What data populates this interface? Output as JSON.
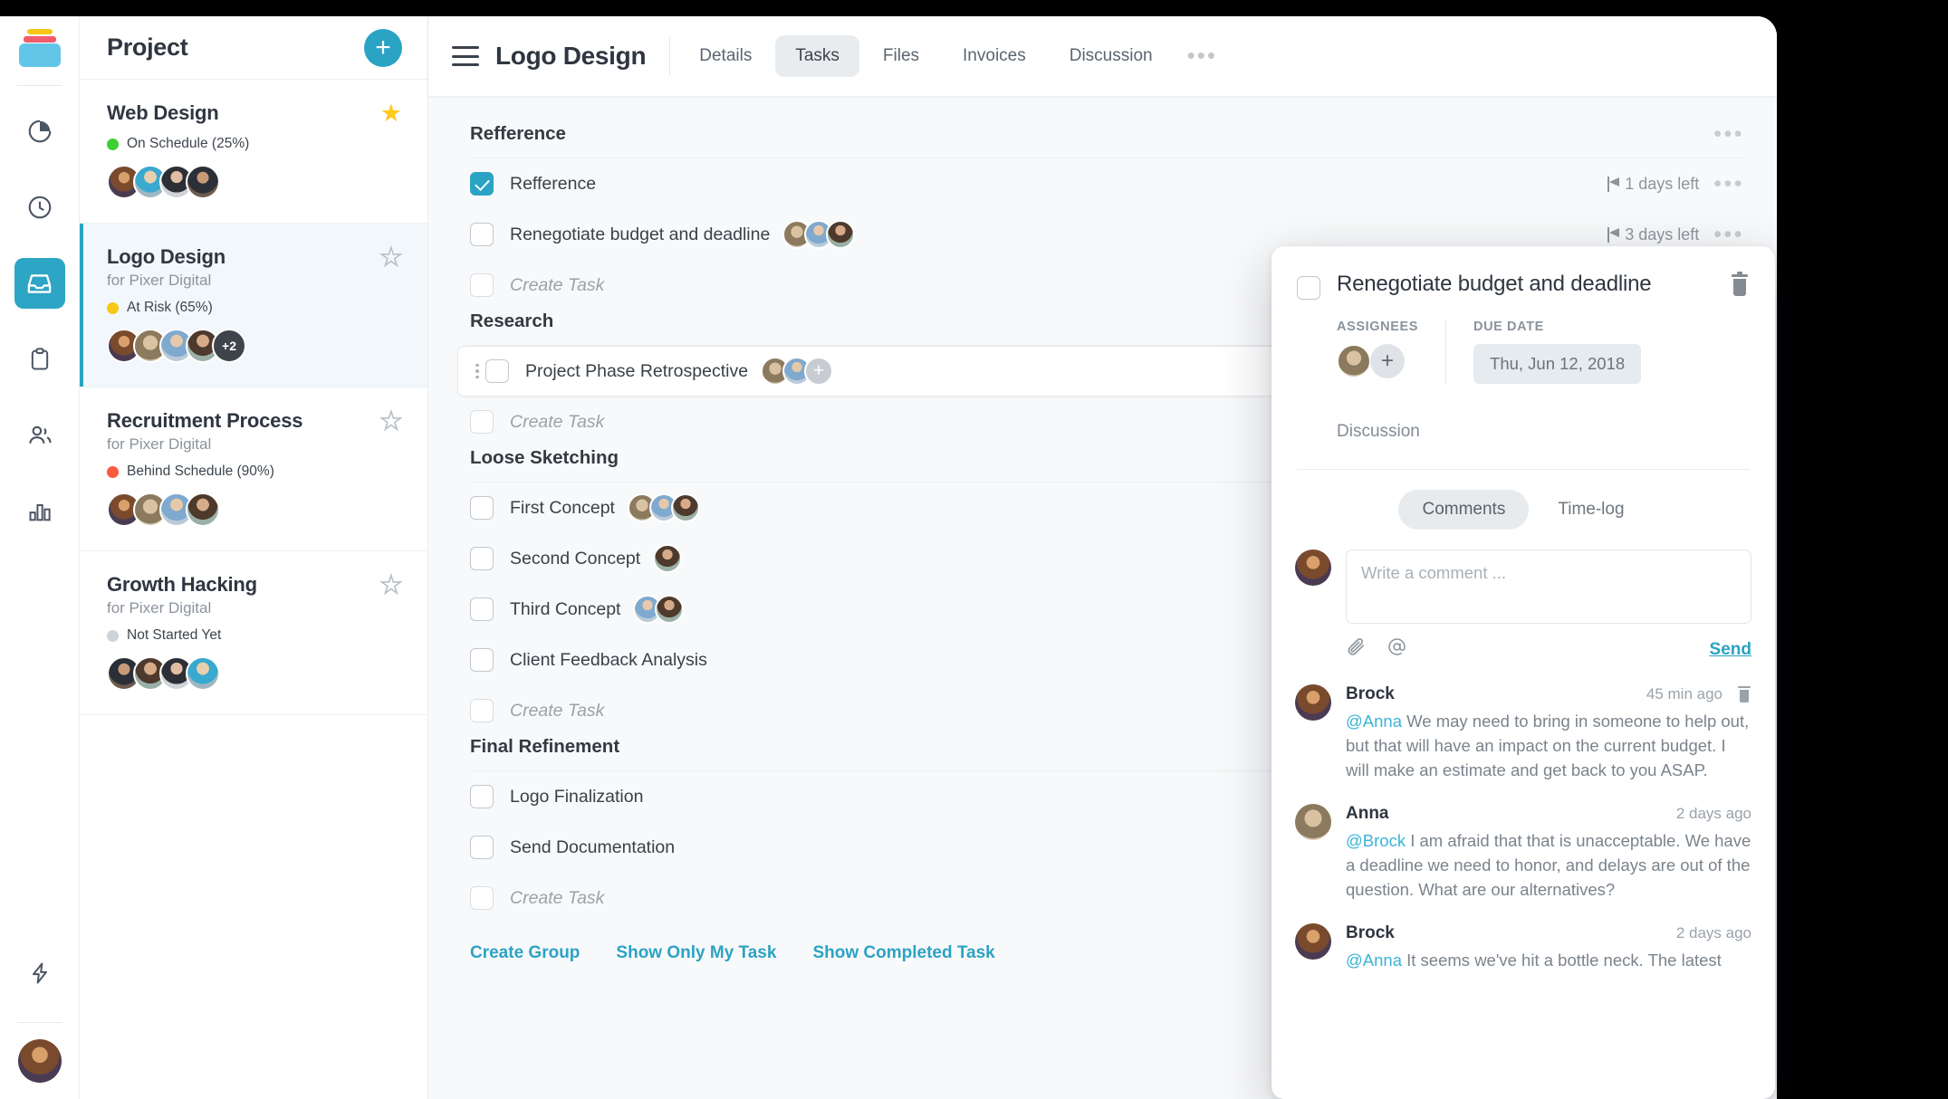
{
  "rail": {
    "logo_name": "app-logo",
    "items": [
      {
        "icon": "pie-chart-icon",
        "active": false
      },
      {
        "icon": "clock-icon",
        "active": false
      },
      {
        "icon": "inbox-icon",
        "active": true
      },
      {
        "icon": "clipboard-icon",
        "active": false
      },
      {
        "icon": "people-icon",
        "active": false
      },
      {
        "icon": "bar-chart-icon",
        "active": false
      }
    ],
    "bottom_icon": "lightning-icon",
    "avatar": "user-avatar"
  },
  "sidebar": {
    "title": "Project",
    "add_label": "+",
    "projects": [
      {
        "name": "Web Design",
        "client": "",
        "status": "On Schedule (25%)",
        "status_color": "#3fcf35",
        "starred": true,
        "selected": false,
        "avatars": [
          "a1",
          "a2",
          "a4",
          "a8"
        ],
        "extra": ""
      },
      {
        "name": "Logo Design",
        "client": "for Pixer Digital",
        "status": "At Risk (65%)",
        "status_color": "#f6c915",
        "starred": false,
        "selected": true,
        "avatars": [
          "a1",
          "a5",
          "a6",
          "a7"
        ],
        "extra": "+2"
      },
      {
        "name": "Recruitment Process",
        "client": "for Pixer Digital",
        "status": "Behind Schedule (90%)",
        "status_color": "#fb5a3c",
        "starred": false,
        "selected": false,
        "avatars": [
          "a1",
          "a5",
          "a6",
          "a7"
        ],
        "extra": ""
      },
      {
        "name": "Growth Hacking",
        "client": "for Pixer Digital",
        "status": "Not Started Yet",
        "status_color": "#cfd4d9",
        "starred": false,
        "selected": false,
        "avatars": [
          "a8",
          "a7",
          "a4",
          "a2"
        ],
        "extra": ""
      }
    ]
  },
  "topbar": {
    "menu_icon": "hamburger-icon",
    "title": "Logo Design",
    "tabs": [
      {
        "label": "Details",
        "active": false
      },
      {
        "label": "Tasks",
        "active": true
      },
      {
        "label": "Files",
        "active": false
      },
      {
        "label": "Invoices",
        "active": false
      },
      {
        "label": "Discussion",
        "active": false
      }
    ],
    "more_label": "•••"
  },
  "board": {
    "groups": [
      {
        "title": "Refference",
        "menu": "•••",
        "tasks": [
          {
            "label": "Refference",
            "done": true,
            "ghost": false,
            "avatars": [],
            "plus": false,
            "due": "1 days left",
            "menu": "•••",
            "hover": false
          },
          {
            "label": "Renegotiate budget and deadline",
            "done": false,
            "ghost": false,
            "avatars": [
              "a5",
              "a6",
              "a7"
            ],
            "plus": false,
            "due": "3 days left",
            "menu": "•••",
            "hover": false
          },
          {
            "label": "Create Task",
            "done": false,
            "ghost": true,
            "avatars": [],
            "plus": false,
            "due": "",
            "menu": "",
            "hover": false
          }
        ]
      },
      {
        "title": "Research",
        "menu": "",
        "tasks": [
          {
            "label": "Project Phase Retrospective",
            "done": false,
            "ghost": false,
            "avatars": [
              "a5",
              "a6"
            ],
            "plus": true,
            "due": "",
            "menu": "",
            "hover": true
          },
          {
            "label": "Create Task",
            "done": false,
            "ghost": true,
            "avatars": [],
            "plus": false,
            "due": "",
            "menu": "",
            "hover": false
          }
        ]
      },
      {
        "title": "Loose Sketching",
        "menu": "",
        "tasks": [
          {
            "label": "First Concept",
            "done": false,
            "ghost": false,
            "avatars": [
              "a5",
              "a6",
              "a7"
            ],
            "plus": false,
            "due": "",
            "menu": "",
            "hover": false
          },
          {
            "label": "Second Concept",
            "done": false,
            "ghost": false,
            "avatars": [
              "a7"
            ],
            "plus": false,
            "due": "",
            "menu": "",
            "hover": false
          },
          {
            "label": "Third Concept",
            "done": false,
            "ghost": false,
            "avatars": [
              "a6",
              "a7"
            ],
            "plus": false,
            "due": "",
            "menu": "",
            "hover": false
          },
          {
            "label": "Client Feedback Analysis",
            "done": false,
            "ghost": false,
            "avatars": [],
            "plus": false,
            "due": "",
            "menu": "",
            "hover": false
          },
          {
            "label": "Create Task",
            "done": false,
            "ghost": true,
            "avatars": [],
            "plus": false,
            "due": "",
            "menu": "",
            "hover": false
          }
        ]
      },
      {
        "title": "Final Refinement",
        "menu": "",
        "tasks": [
          {
            "label": "Logo Finalization",
            "done": false,
            "ghost": false,
            "avatars": [],
            "plus": false,
            "due": "",
            "menu": "",
            "hover": false
          },
          {
            "label": "Send Documentation",
            "done": false,
            "ghost": false,
            "avatars": [],
            "plus": false,
            "due": "",
            "menu": "",
            "hover": false
          },
          {
            "label": "Create Task",
            "done": false,
            "ghost": true,
            "avatars": [],
            "plus": false,
            "due": "",
            "menu": "",
            "hover": false
          }
        ]
      }
    ],
    "footer_links": [
      "Create Group",
      "Show Only My Task",
      "Show Completed Task"
    ]
  },
  "detail": {
    "title": "Renegotiate budget and deadline",
    "delete_icon": "trash-icon",
    "assignees_label": "ASSIGNEES",
    "assignees": [
      "a5"
    ],
    "add_assignee_label": "+",
    "due_label": "DUE DATE",
    "due_value": "Thu, Jun 12, 2018",
    "discussion_label": "Discussion",
    "tabs": [
      {
        "label": "Comments",
        "active": true
      },
      {
        "label": "Time-log",
        "active": false
      }
    ],
    "composer": {
      "avatar": "a1",
      "placeholder": "Write a comment ...",
      "attach_icon": "paperclip-icon",
      "mention_icon": "at-icon",
      "send_label": "Send"
    },
    "comments": [
      {
        "avatar": "a1",
        "author": "Brock",
        "time": "45 min ago",
        "mention": "@Anna",
        "text": " We may need to bring in someone to help out, but that will have an impact on the current budget. I will make an estimate and get back to you ASAP.",
        "deletable": true
      },
      {
        "avatar": "a5",
        "author": "Anna",
        "time": "2 days ago",
        "mention": "@Brock",
        "text": " I am afraid that that is unacceptable. We have a deadline we need to honor, and delays are out of the question. What are our alternatives?",
        "deletable": false
      },
      {
        "avatar": "a1",
        "author": "Brock",
        "time": "2 days ago",
        "mention": "@Anna",
        "text": " It seems we've hit a bottle neck. The latest",
        "deletable": false
      }
    ]
  },
  "colors": {
    "accent": "#2ba3c4",
    "green": "#3fcf35",
    "yellow": "#f6c915",
    "red": "#fb5a3c",
    "grey": "#cfd4d9",
    "star": "#ffc91d"
  }
}
